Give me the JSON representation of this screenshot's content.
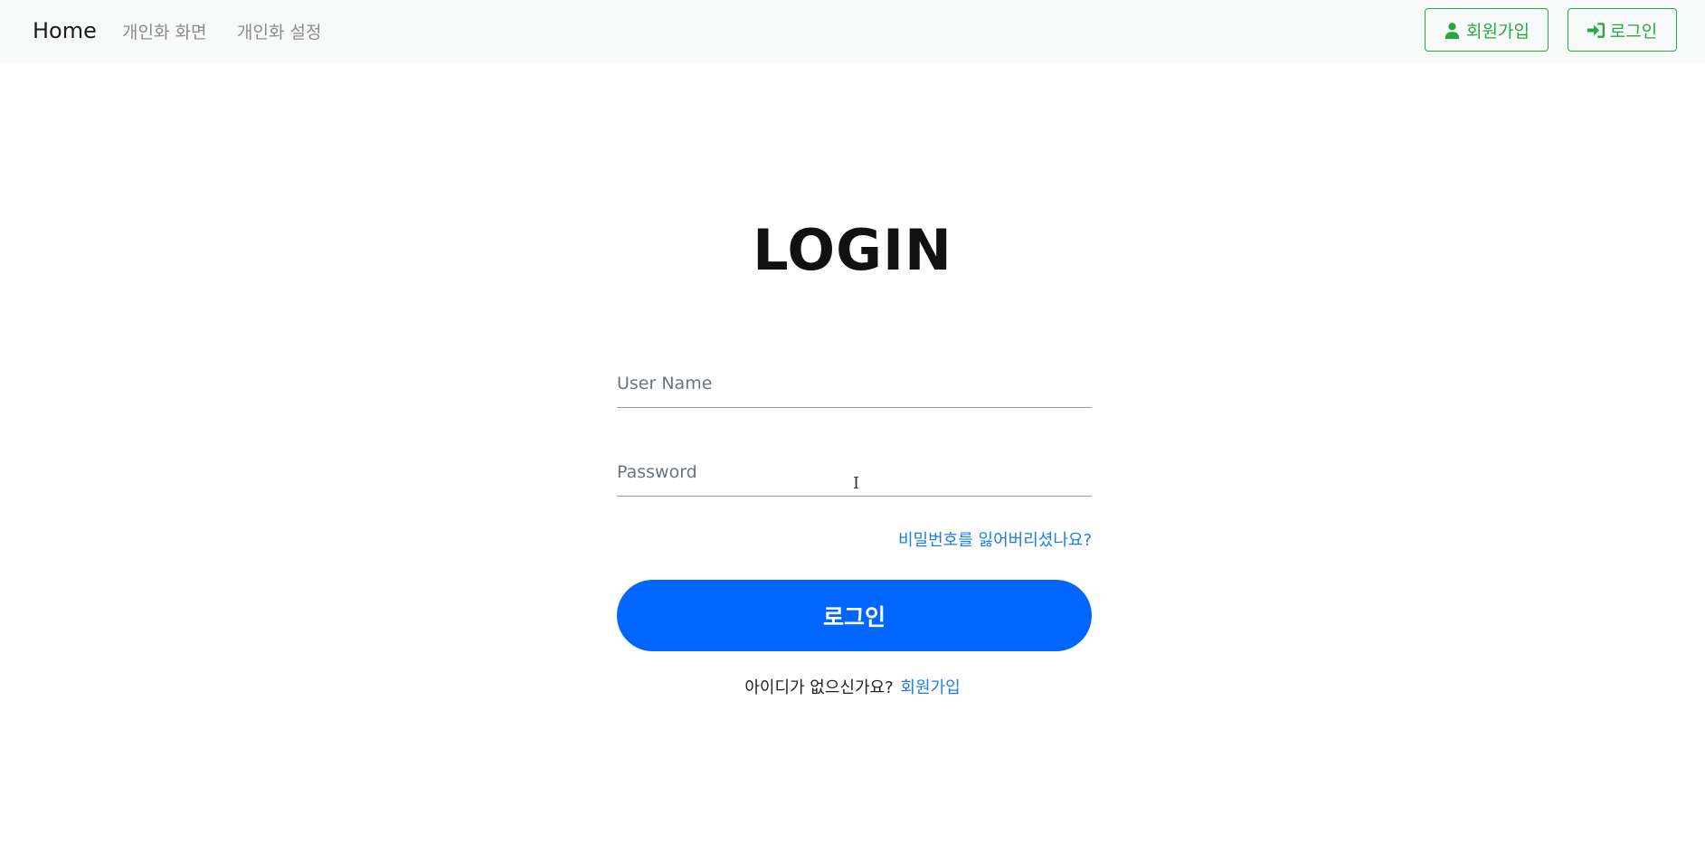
{
  "navbar": {
    "brand": "Home",
    "links": [
      "개인화 화면",
      "개인화 설정"
    ],
    "signup_button": {
      "label": "회원가입",
      "icon": "user-icon"
    },
    "login_button": {
      "label": "로그인",
      "icon": "sign-in-icon"
    },
    "accent_color": "#28a745"
  },
  "login": {
    "title": "LOGIN",
    "username_placeholder": "User Name",
    "password_placeholder": "Password",
    "forgot_link": "비밀번호를 잃어버리셨나요?",
    "submit_label": "로그인",
    "no_account_text": "아이디가 없으신가요?",
    "signup_link": "회원가입",
    "primary_color": "#0066ff",
    "link_color": "#1e7fe0"
  }
}
